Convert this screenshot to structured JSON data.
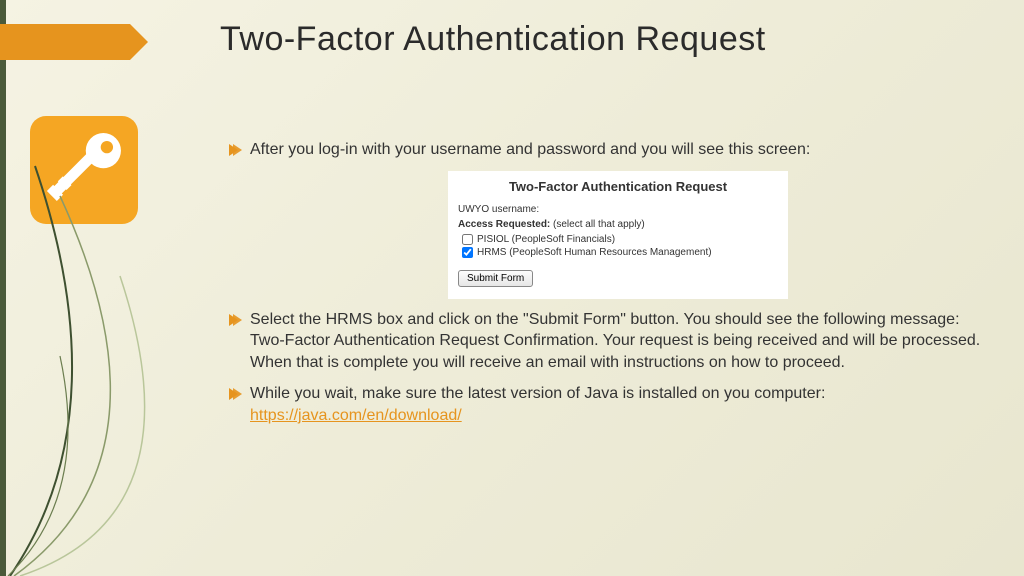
{
  "title": "Two-Factor Authentication Request",
  "bullets": {
    "b1": "After you log-in with your username and password and you will see this screen:",
    "b2": "Select the HRMS box and click on the \"Submit Form\" button. You should see the following message: Two-Factor Authentication Request Confirmation. Your request is being received and will be processed.  When that is complete you will receive an email with instructions on how to proceed.",
    "b3_prefix": "While you wait, make sure the latest version of Java is installed on you computer:  ",
    "b3_link": "https://java.com/en/download/"
  },
  "screenshot": {
    "title": "Two-Factor Authentication Request",
    "username_label": "UWYO username:",
    "access_label": "Access Requested:",
    "access_hint": " (select all that apply)",
    "opt_pisiol": "PISIOL (PeopleSoft Financials)",
    "opt_hrms": "HRMS (PeopleSoft Human Resources Management)",
    "submit": "Submit Form"
  }
}
